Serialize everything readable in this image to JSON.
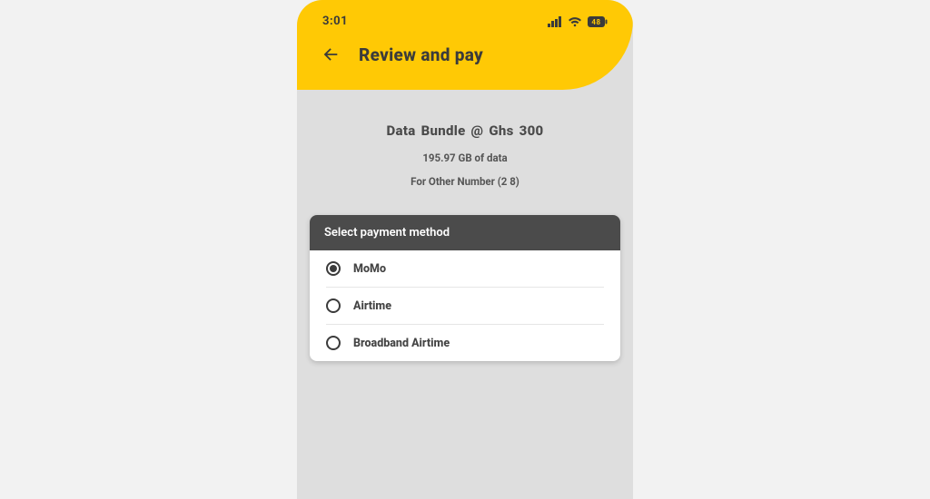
{
  "status": {
    "time": "3:01"
  },
  "header": {
    "title": "Review and pay"
  },
  "summary": {
    "title": "Data  Bundle @  Ghs 300",
    "detail": "195.97 GB  of data",
    "recipient": "For Other Number (2                     8)"
  },
  "payment": {
    "header": "Select payment method",
    "options": [
      {
        "label": "MoMo",
        "selected": true
      },
      {
        "label": "Airtime",
        "selected": false
      },
      {
        "label": "Broadband Airtime",
        "selected": false
      }
    ]
  }
}
